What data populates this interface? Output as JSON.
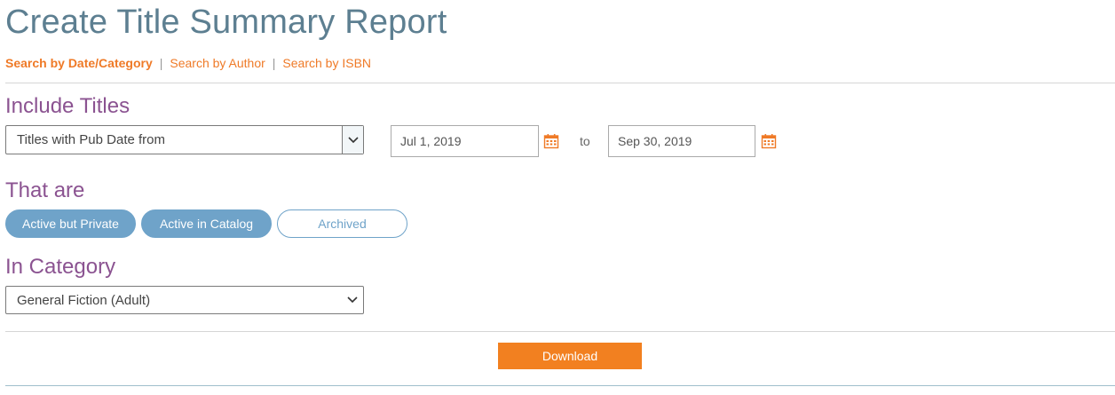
{
  "page": {
    "title": "Create Title Summary Report"
  },
  "search_nav": {
    "items": [
      {
        "label": "Search by Date/Category",
        "active": true
      },
      {
        "label": "Search by Author",
        "active": false
      },
      {
        "label": "Search by ISBN",
        "active": false
      }
    ],
    "separator": "|"
  },
  "include_titles": {
    "heading": "Include Titles",
    "filter_select_value": "Titles with Pub Date from",
    "start_date": "Jul 1, 2019",
    "to_label": "to",
    "end_date": "Sep 30, 2019"
  },
  "status": {
    "heading": "That are",
    "options": [
      {
        "label": "Active but Private",
        "selected": true
      },
      {
        "label": "Active in Catalog",
        "selected": true
      },
      {
        "label": "Archived",
        "selected": false
      }
    ]
  },
  "category": {
    "heading": "In Category",
    "select_value": "General Fiction (Adult)"
  },
  "actions": {
    "download_label": "Download"
  },
  "colors": {
    "title": "#5d7f91",
    "link_orange": "#ef7a27",
    "heading_purple": "#8b5391",
    "pill_blue": "#6fa3c9",
    "button_orange": "#f28020",
    "calendar_icon": "#ef7a27"
  },
  "icons": {
    "select_chevron": "chevron-down-icon",
    "date_picker": "calendar-icon"
  }
}
